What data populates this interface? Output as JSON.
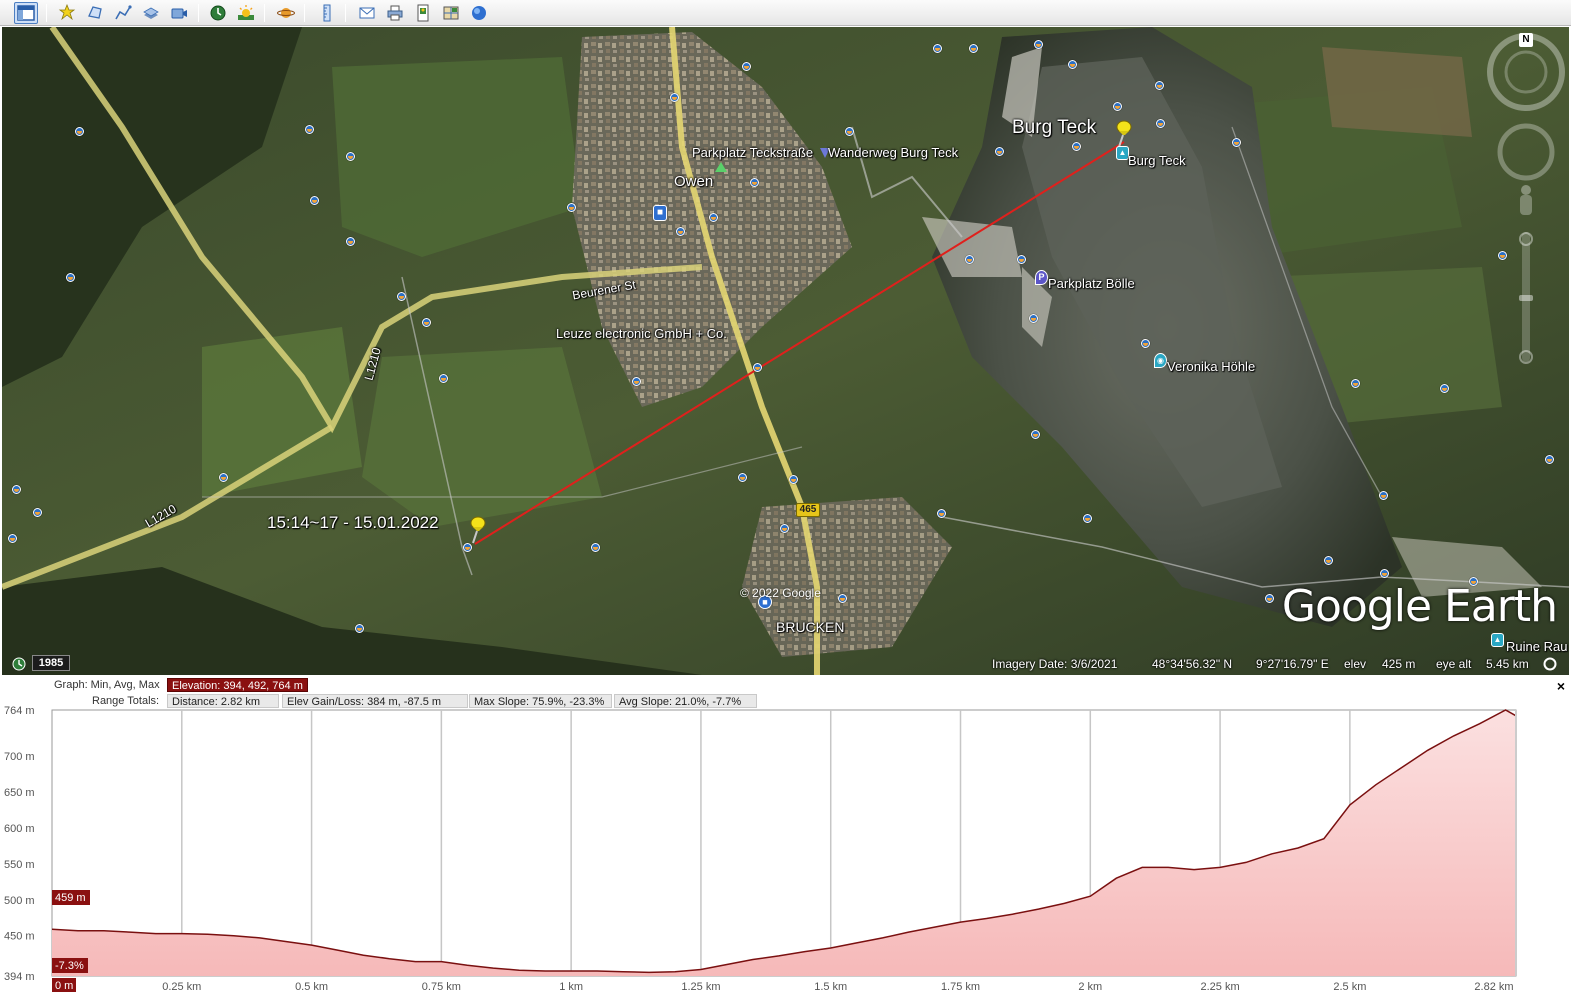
{
  "toolbar": {
    "buttons": [
      {
        "name": "sidebar-toggle-button",
        "icon": "sidebar-icon"
      },
      {
        "name": "add-placemark-button",
        "icon": "pushpin-icon"
      },
      {
        "name": "add-polygon-button",
        "icon": "polygon-icon"
      },
      {
        "name": "add-path-button",
        "icon": "path-icon"
      },
      {
        "name": "add-image-overlay-button",
        "icon": "overlay-icon"
      },
      {
        "name": "record-tour-button",
        "icon": "tour-icon"
      },
      {
        "name": "historical-imagery-button",
        "icon": "clock-icon"
      },
      {
        "name": "sunlight-button",
        "icon": "sun-icon"
      },
      {
        "name": "switch-planet-button",
        "icon": "planet-icon"
      },
      {
        "name": "ruler-button",
        "icon": "ruler-icon"
      },
      {
        "name": "email-button",
        "icon": "email-icon"
      },
      {
        "name": "print-button",
        "icon": "print-icon"
      },
      {
        "name": "save-image-button",
        "icon": "save-image-icon"
      },
      {
        "name": "view-in-maps-button",
        "icon": "maps-icon"
      },
      {
        "name": "earth-button",
        "icon": "earth-icon"
      }
    ]
  },
  "map": {
    "labels": {
      "burg_teck_big": "Burg Teck",
      "burg_teck_small": "Burg Teck",
      "parkplatz_teckstrasse": "Parkplatz Teckstraße",
      "wanderweg": "Wanderweg Burg Teck",
      "owen": "Owen",
      "beurener": "Beurener St",
      "leuze": "Leuze electronic GmbH + Co.",
      "parkplatz_bolle": "Parkplatz Bölle",
      "veronika": "Veronika Höhle",
      "track_label": "15:14~17 - 15.01.2022",
      "brucken": "BRUCKEN",
      "road_465": "465",
      "l1210_a": "L1210",
      "l1210_b": "L1210",
      "ruine": "Ruine Rau"
    },
    "copyright": "© 2022 Google",
    "logo": "Google Earth",
    "compass_letter": "N",
    "historical_year": "1985",
    "status": {
      "imagery_date": "Imagery Date: 3/6/2021",
      "lat": "48°34'56.32\" N",
      "lon": "9°27'16.79\" E",
      "elev_label": "elev",
      "elev_value": "425 m",
      "eye_alt_label": "eye alt",
      "eye_alt_value": "5.45 km"
    }
  },
  "profile": {
    "graph_label": "Graph: Min, Avg, Max",
    "elevation_box": "Elevation: 394, 492, 764 m",
    "range_totals_label": "Range Totals:",
    "distance_box": "Distance: 2.82 km",
    "gain_loss_box": "Elev Gain/Loss: 384 m, -87.5 m",
    "max_slope_box": "Max Slope: 75.9%, -23.3%",
    "avg_slope_box": "Avg Slope: 21.0%, -7.7%",
    "close_glyph": "×",
    "cursor_elev": "459 m",
    "cursor_slope": "-7.3%",
    "cursor_dist": "0 m"
  },
  "chart_data": {
    "type": "area",
    "xlabel": "",
    "ylabel": "",
    "x_ticks": [
      "0.25 km",
      "0.5 km",
      "0.75 km",
      "1 km",
      "1.25 km",
      "1.5 km",
      "1.75 km",
      "2 km",
      "2.25 km",
      "2.5 km",
      "2.82 km"
    ],
    "x_tick_values": [
      0.25,
      0.5,
      0.75,
      1.0,
      1.25,
      1.5,
      1.75,
      2.0,
      2.25,
      2.5,
      2.82
    ],
    "y_ticks": [
      "764 m",
      "700 m",
      "650 m",
      "600 m",
      "550 m",
      "500 m",
      "450 m",
      "394 m"
    ],
    "y_tick_values": [
      764,
      700,
      650,
      600,
      550,
      500,
      450,
      394
    ],
    "xlim": [
      0,
      2.82
    ],
    "ylim": [
      394,
      764
    ],
    "grid": true,
    "colors": {
      "line": "#7a1010",
      "fill": "#f6b9b9",
      "fill_top": "#fbe0e0"
    },
    "x": [
      0.0,
      0.05,
      0.1,
      0.15,
      0.2,
      0.25,
      0.3,
      0.35,
      0.4,
      0.45,
      0.5,
      0.55,
      0.6,
      0.65,
      0.7,
      0.75,
      0.8,
      0.85,
      0.9,
      0.95,
      1.0,
      1.05,
      1.1,
      1.15,
      1.2,
      1.25,
      1.3,
      1.35,
      1.4,
      1.45,
      1.5,
      1.55,
      1.6,
      1.65,
      1.7,
      1.75,
      1.8,
      1.85,
      1.9,
      1.95,
      2.0,
      2.05,
      2.1,
      2.15,
      2.2,
      2.25,
      2.3,
      2.35,
      2.4,
      2.45,
      2.5,
      2.55,
      2.6,
      2.65,
      2.7,
      2.75,
      2.8,
      2.82
    ],
    "y": [
      459,
      457,
      457,
      455,
      453,
      453,
      452,
      450,
      447,
      442,
      437,
      430,
      423,
      418,
      414,
      414,
      409,
      405,
      402,
      401,
      401,
      401,
      400,
      399,
      400,
      403,
      410,
      417,
      422,
      428,
      433,
      440,
      447,
      455,
      462,
      469,
      474,
      480,
      487,
      495,
      505,
      530,
      545,
      545,
      542,
      545,
      552,
      564,
      572,
      585,
      632,
      660,
      684,
      708,
      728,
      745,
      764,
      756
    ]
  }
}
